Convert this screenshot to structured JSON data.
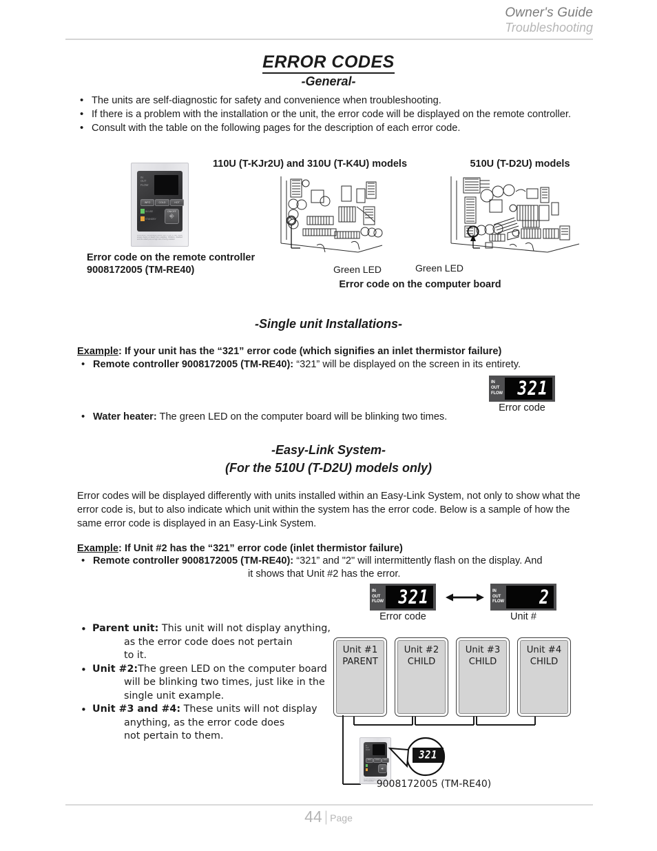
{
  "header": {
    "guide": "Owner's Guide",
    "section": "Troubleshooting"
  },
  "titles": {
    "main": "ERROR CODES",
    "general": "-General-",
    "single_unit": "-Single unit Installations-",
    "easylink": "-Easy-Link System-",
    "easylink_sub": "(For the 510U (T-D2U) models only)"
  },
  "general_bullets": [
    "The units are self-diagnostic for safety and convenience when troubleshooting.",
    "If there is a problem with the installation or the unit, the error code will be displayed on the remote controller.",
    "Consult with the table on the following pages for the description of each error code."
  ],
  "figures": {
    "label_110u": "110U (T-KJr2U) and 310U (T-K4U) models",
    "label_510u": "510U (T-D2U) models",
    "caption_remote": "Error code on the remote controller 9008172005 (TM-RE40)",
    "caption_computer": "Error code on the computer board",
    "green_led_1": "Green LED",
    "green_led_2": "Green LED"
  },
  "remote_face": {
    "in": "IN",
    "out": "OUT",
    "flow": "FLOW",
    "btn_info": "INFO",
    "btn_cold": "COLD",
    "btn_hot": "HOT",
    "led_inuse": "IN USE",
    "led_standby": "STANDBY",
    "power": "ON/OFF",
    "warning": "WARNING: Temperature above 120°F (49°C) can cause severe burns or death from scalding. Children, disabled and the elderly are at high risk of being scalded."
  },
  "single_unit": {
    "example_label": "Example",
    "example_text": ": If your unit has the “321” error code (which signifies an inlet thermistor failure)",
    "bullet1_bold": "Remote controller 9008172005 (TM-RE40):",
    "bullet1_rest": " “321” will be displayed on the screen in its entirety.",
    "bullet2_bold": "Water heater:",
    "bullet2_rest": " The green LED on the computer board will be blinking two times.",
    "display_value": "321",
    "display_caption": "Error code"
  },
  "easylink": {
    "paragraph": "Error codes will be displayed differently with units installed within an Easy-Link System, not only to show what the error code is, but to also indicate which unit within the system has the error code.  Below is a sample of how the same error code is displayed in an Easy-Link System.",
    "example_label": "Example",
    "example_text": ": If Unit #2 has the “321” error code (inlet thermistor failure)",
    "bullet1_bold": "Remote controller 9008172005 (TM-RE40):",
    "bullet1_rest": " “321” and \"2\" will intermittently flash on the display.  And",
    "bullet1_cont": "it shows that Unit #2 has the error.",
    "display_error_value": "321",
    "display_error_caption": "Error code",
    "display_unit_value": "2",
    "display_unit_caption": "Unit #"
  },
  "bottom_bullets": [
    {
      "bold": "Parent unit:",
      "lines": [
        " This unit will not display anything,",
        "as the error code does not pertain",
        "to it."
      ]
    },
    {
      "bold": "Unit #2:",
      "lines": [
        "The green LED on the computer board",
        "will be blinking two times, just like in the",
        "single unit example."
      ]
    },
    {
      "bold": "Unit #3 and #4:",
      "lines": [
        " These units will not display",
        "anything, as the error code does",
        "not pertain to them."
      ]
    }
  ],
  "units": [
    {
      "name": "Unit #1",
      "role": "PARENT"
    },
    {
      "name": "Unit #2",
      "role": "CHILD"
    },
    {
      "name": "Unit #3",
      "role": "CHILD"
    },
    {
      "name": "Unit #4",
      "role": "CHILD"
    }
  ],
  "callout": {
    "code": "321",
    "caption": "9008172005 (TM-RE40)"
  },
  "footer": {
    "page_number": "44",
    "page_word": "Page"
  },
  "colors": {
    "text": "#1b1b1b",
    "header_guide": "#7b7b7b",
    "header_section": "#b6b6b6",
    "rule": "#d4d4d4",
    "display_bezel": "#4f4f51",
    "display_screen": "#050505",
    "unit_box_fill": "#d4d4d4",
    "led_green": "#63c463",
    "led_orange": "#e8a33c",
    "footer": "#b5b5b5"
  }
}
